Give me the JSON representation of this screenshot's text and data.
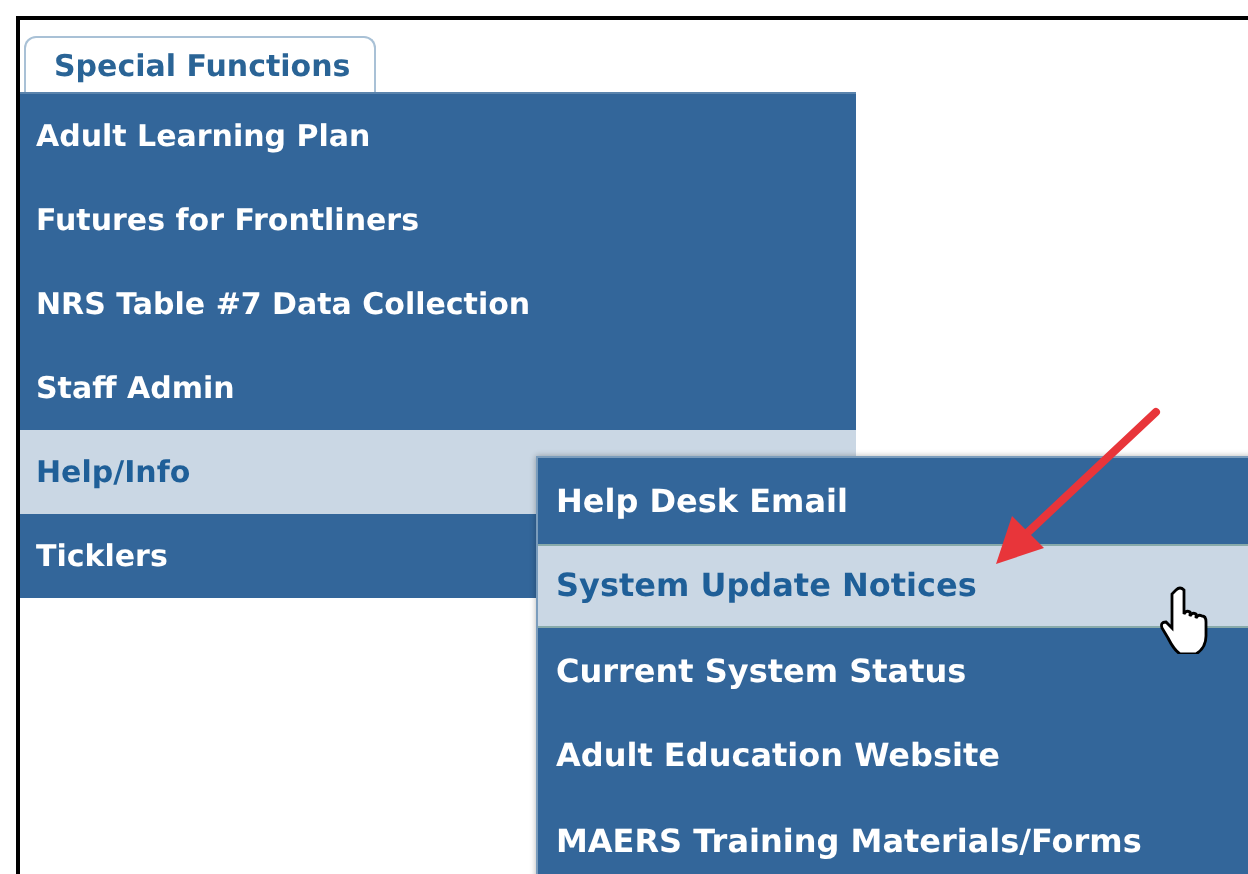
{
  "tab": {
    "label": "Special Functions",
    "selected": true
  },
  "menu": {
    "items": [
      {
        "label": "Adult Learning Plan",
        "selected": false
      },
      {
        "label": "Futures for Frontliners",
        "selected": false
      },
      {
        "label": "NRS Table #7 Data Collection",
        "selected": false
      },
      {
        "label": "Staff Admin",
        "selected": false
      },
      {
        "label": "Help/Info",
        "selected": true,
        "children": [
          {
            "label": "Help Desk Email",
            "selected": false
          },
          {
            "label": "System Update Notices",
            "selected": true
          },
          {
            "label": "Current System Status",
            "selected": false
          },
          {
            "label": "Adult Education Website",
            "selected": false
          },
          {
            "label": "MAERS Training Materials/Forms",
            "selected": false
          }
        ]
      },
      {
        "label": "Ticklers",
        "selected": false
      }
    ]
  }
}
